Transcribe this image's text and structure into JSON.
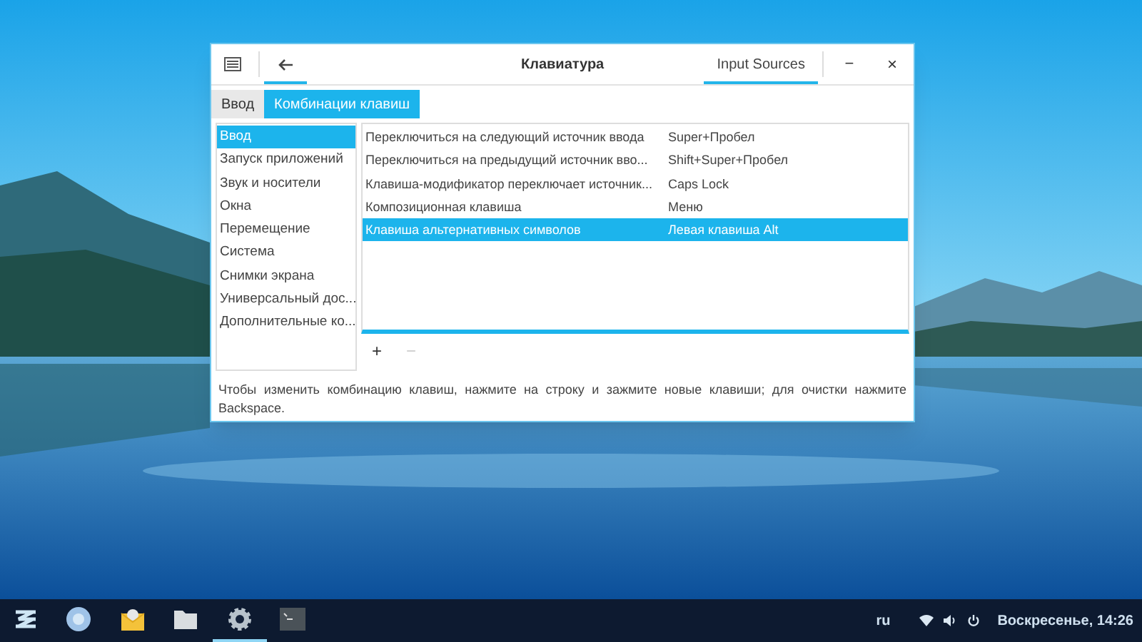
{
  "window": {
    "title": "Клавиатура",
    "header_button": "Input Sources",
    "minimize": "−",
    "close": "×"
  },
  "tabs": [
    {
      "label": "Ввод",
      "selected": false
    },
    {
      "label": "Комбинации клавиш",
      "selected": true
    }
  ],
  "categories": [
    {
      "label": "Ввод",
      "selected": true
    },
    {
      "label": "Запуск приложений",
      "selected": false
    },
    {
      "label": "Звук и носители",
      "selected": false
    },
    {
      "label": "Окна",
      "selected": false
    },
    {
      "label": "Перемещение",
      "selected": false
    },
    {
      "label": "Система",
      "selected": false
    },
    {
      "label": "Снимки экрана",
      "selected": false
    },
    {
      "label": "Универсальный дос...",
      "selected": false
    },
    {
      "label": "Дополнительные ко...",
      "selected": false
    }
  ],
  "shortcuts": [
    {
      "action": "Переключиться на следующий источник ввода",
      "keys": "Super+Пробел",
      "selected": false
    },
    {
      "action": "Переключиться на предыдущий источник вво...",
      "keys": "Shift+Super+Пробел",
      "selected": false
    },
    {
      "action": "Клавиша-модификатор переключает источник...",
      "keys": "Caps Lock",
      "selected": false
    },
    {
      "action": "Композиционная клавиша",
      "keys": "Меню",
      "selected": false
    },
    {
      "action": "Клавиша альтернативных символов",
      "keys": "Левая клавиша Alt",
      "selected": true
    }
  ],
  "add_button": "+",
  "remove_button": {
    "label": "−",
    "disabled": true
  },
  "hint": "Чтобы изменить комбинацию клавиш, нажмите на строку и зажмите новые клавиши; для очистки нажмите Backspace.",
  "taskbar": {
    "apps": [
      {
        "kind": "launcher",
        "selected": false
      },
      {
        "kind": "browser",
        "selected": false
      },
      {
        "kind": "mail",
        "selected": false
      },
      {
        "kind": "files",
        "selected": false
      },
      {
        "kind": "settings",
        "selected": true
      },
      {
        "kind": "terminal",
        "selected": false
      }
    ],
    "language": "ru",
    "clock": "Воскресенье, 14:26"
  }
}
